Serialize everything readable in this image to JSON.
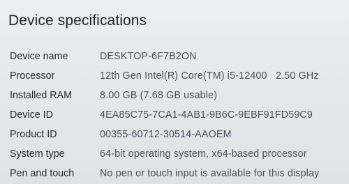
{
  "section": {
    "title": "Device specifications"
  },
  "specs": [
    {
      "label": "Device name",
      "value": "DESKTOP-6F7B2ON"
    },
    {
      "label": "Processor",
      "value": "12th Gen Intel(R) Core(TM) i5-12400   2.50 GHz"
    },
    {
      "label": "Installed RAM",
      "value": "8.00 GB (7.68 GB usable)"
    },
    {
      "label": "Device ID",
      "value": "4EA85C75-7CA1-4AB1-9B6C-9EBF91FD59C9"
    },
    {
      "label": "Product ID",
      "value": "00355-60712-30514-AAOEM"
    },
    {
      "label": "System type",
      "value": "64-bit operating system, x64-based processor"
    },
    {
      "label": "Pen and touch",
      "value": "No pen or touch input is available for this display"
    }
  ]
}
